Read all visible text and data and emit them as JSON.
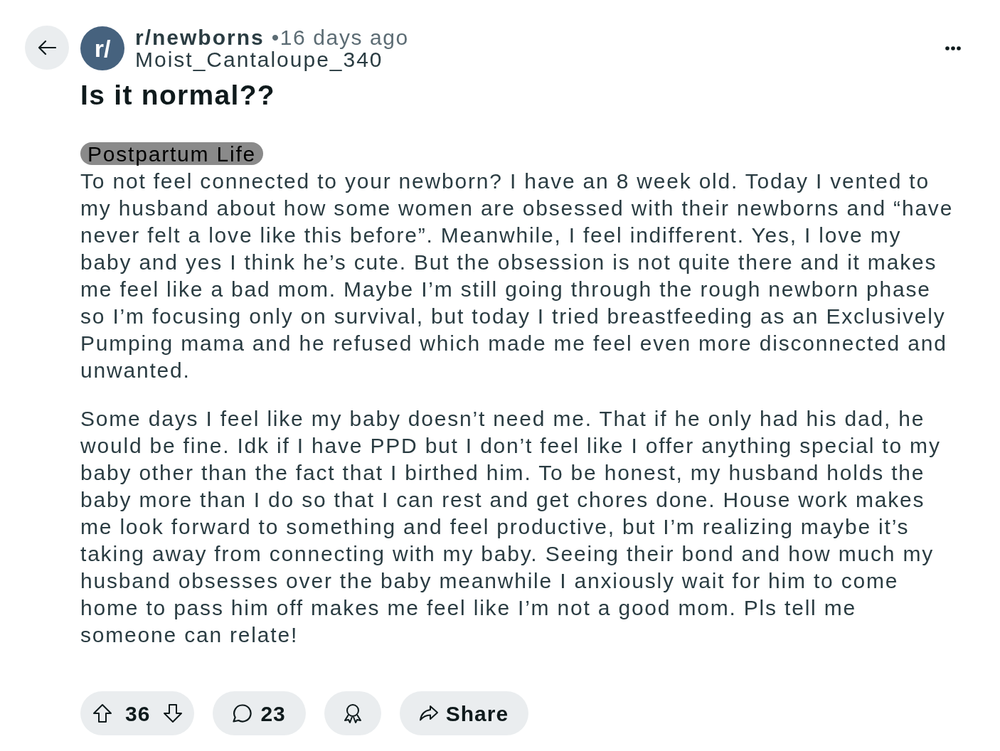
{
  "post": {
    "subreddit": "r/newborns",
    "avatar_text": "r/",
    "time": "•16 days ago",
    "author": "Moist_Cantaloupe_340",
    "title": "Is it normal??",
    "flair": "Postpartum Life",
    "body": [
      "To not feel connected to your newborn? I have an 8 week old. Today I vented to my husband about how some women are obsessed with their newborns and “have never felt a love like this before”. Meanwhile, I feel indifferent. Yes, I love my baby and yes I think he’s cute. But the obsession is not quite there and it makes me feel like a bad mom. Maybe I’m still going through the rough newborn phase so I’m focusing only on survival, but today I tried breastfeeding as an Exclusively Pumping mama and he refused which made me feel even more disconnected and unwanted.",
      "Some days I feel like my baby doesn’t need me. That if he only had his dad, he would be fine. Idk if I have PPD but I don’t feel like I offer anything special to my baby other than the fact that I birthed him. To be honest, my husband holds the baby more than I do so that I can rest and get chores done. House work makes me look forward to something and feel productive, but I’m realizing maybe it’s taking away from connecting with my baby. Seeing their bond and how much my husband obsesses over the baby meanwhile I anxiously wait for him to come home to pass him off makes me feel like I’m not a good mom. Pls tell me someone can relate!"
    ]
  },
  "actions": [
    {
      "kind": "vote",
      "label": "36"
    },
    {
      "kind": "comments",
      "label": "23"
    },
    {
      "kind": "award"
    },
    {
      "kind": "share",
      "label": "Share"
    }
  ]
}
